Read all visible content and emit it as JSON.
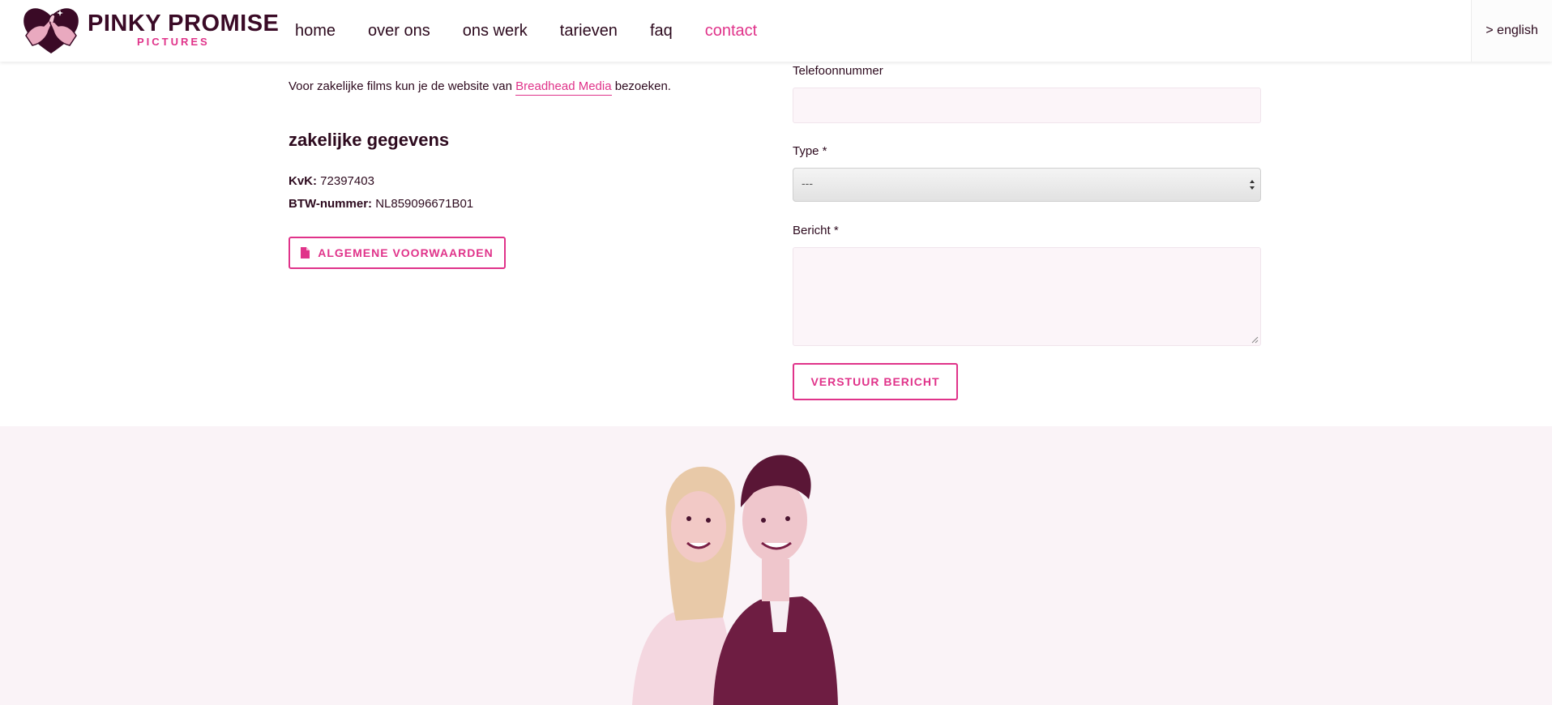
{
  "brand": {
    "name": "PINKY PROMISE",
    "tagline": "PICTURES"
  },
  "nav": {
    "items": [
      {
        "label": "home",
        "active": false
      },
      {
        "label": "over ons",
        "active": false
      },
      {
        "label": "ons werk",
        "active": false
      },
      {
        "label": "tarieven",
        "active": false
      },
      {
        "label": "faq",
        "active": false
      },
      {
        "label": "contact",
        "active": true
      }
    ],
    "language_link": "> english"
  },
  "info": {
    "intro_before": "Voor zakelijke films kun je de website van ",
    "intro_link": "Breadhead Media",
    "intro_after": " bezoeken.",
    "section_title": "zakelijke gegevens",
    "kvk_label": "KvK:",
    "kvk_value": " 72397403",
    "btw_label": "BTW-nummer:",
    "btw_value": " NL859096671B01",
    "terms_button": "ALGEMENE VOORWAARDEN",
    "terms_icon": "document-icon"
  },
  "form": {
    "phone_label": "Telefoonnummer",
    "phone_value": "",
    "type_label": "Type *",
    "type_selected": "---",
    "message_label": "Bericht *",
    "message_value": "",
    "submit_label": "VERSTUUR BERICHT"
  },
  "colors": {
    "accent": "#e0338a",
    "text": "#2d0a1e",
    "band": "#faf3f7",
    "field": "#fcf5f9"
  }
}
